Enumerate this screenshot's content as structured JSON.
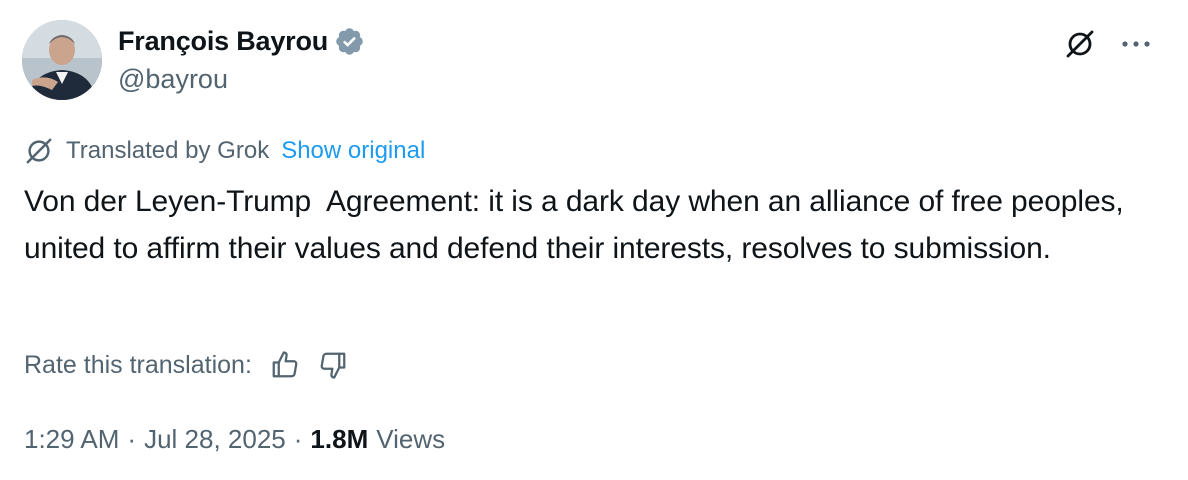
{
  "author": {
    "display_name": "François Bayrou",
    "handle": "@bayrou",
    "verified": true,
    "verified_color": "#1d9bf0"
  },
  "translation": {
    "label": "Translated by Grok",
    "show_original": "Show original",
    "rate_label": "Rate this translation:"
  },
  "tweet": {
    "text": "Von der Leyen-Trump  Agreement: it is a dark day when an alliance of free peoples, united to affirm their values and defend their interests, resolves to submission."
  },
  "meta": {
    "time": "1:29 AM",
    "separator": "·",
    "date": "Jul 28, 2025",
    "views_count": "1.8M",
    "views_label": "Views"
  },
  "colors": {
    "text_primary": "#0f1419",
    "text_secondary": "#536471",
    "accent": "#1d9bf0"
  },
  "icons": {
    "grok": "grok-icon",
    "more": "more-icon",
    "verified": "verified-badge-icon",
    "thumb_up": "thumbs-up-icon",
    "thumb_down": "thumbs-down-icon"
  }
}
